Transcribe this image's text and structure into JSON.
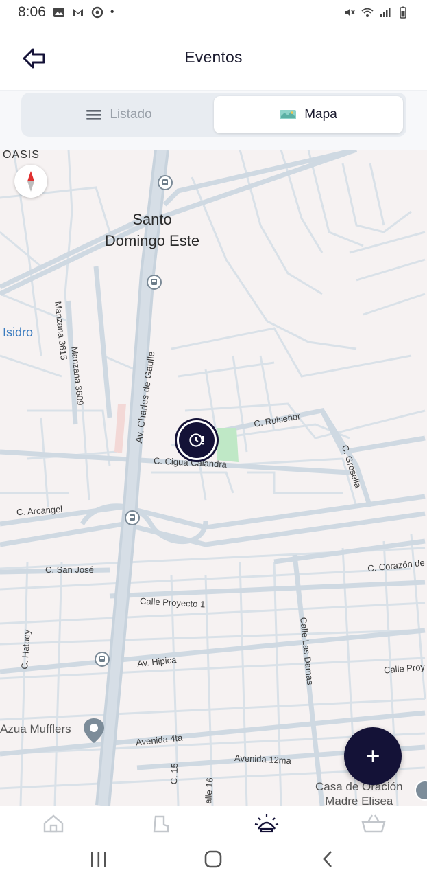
{
  "status_bar": {
    "time": "8:06",
    "dot": "•"
  },
  "header": {
    "title": "Eventos",
    "back_icon": "back-arrow-icon"
  },
  "segment": {
    "list_label": "Listado",
    "map_label": "Mapa",
    "active": "map"
  },
  "map": {
    "places": {
      "oasis": "OASIS",
      "santo": "Santo",
      "domingo_este": "Domingo Este",
      "isidro": "Isidro",
      "azua_mufflers": "Azua Mufflers",
      "casa_oracion_1": "Casa de Oración",
      "casa_oracion_2": "Madre Elisea"
    },
    "streets": {
      "manzana_3615": "Manzana 3615",
      "manzana_3609": "Manzana 3609",
      "charles_de_gaulle": "Av. Charles de Gaulle",
      "ruisenor": "C. Ruiseñor",
      "cigua_calandra": "C. Cigua Calandra",
      "grosella": "C. Grosella",
      "arcangel": "C. Arcangel",
      "san_jose": "C. San José",
      "corazon": "C. Corazón de",
      "proyecto_1": "Calle Proyecto 1",
      "las_damas": "Calle Las Damas",
      "hatuey": "C. Hatuey",
      "hipica": "Av. Hipica",
      "calle_proy": "Calle Proy",
      "avenida_4ta": "Avenida 4ta",
      "avenida_12ma": "Avenida 12ma",
      "c15": "C. 15",
      "calle16": "alle 16"
    }
  },
  "fab": {
    "label": "+"
  },
  "bottom_nav": [
    "home-icon",
    "boot-icon",
    "events-icon",
    "cart-icon"
  ],
  "colors": {
    "primary": "#141237",
    "map_bg": "#f6f2f2",
    "road": "#d5dee6",
    "park": "#bfe8c6",
    "place_blue": "#3a7bbf"
  }
}
